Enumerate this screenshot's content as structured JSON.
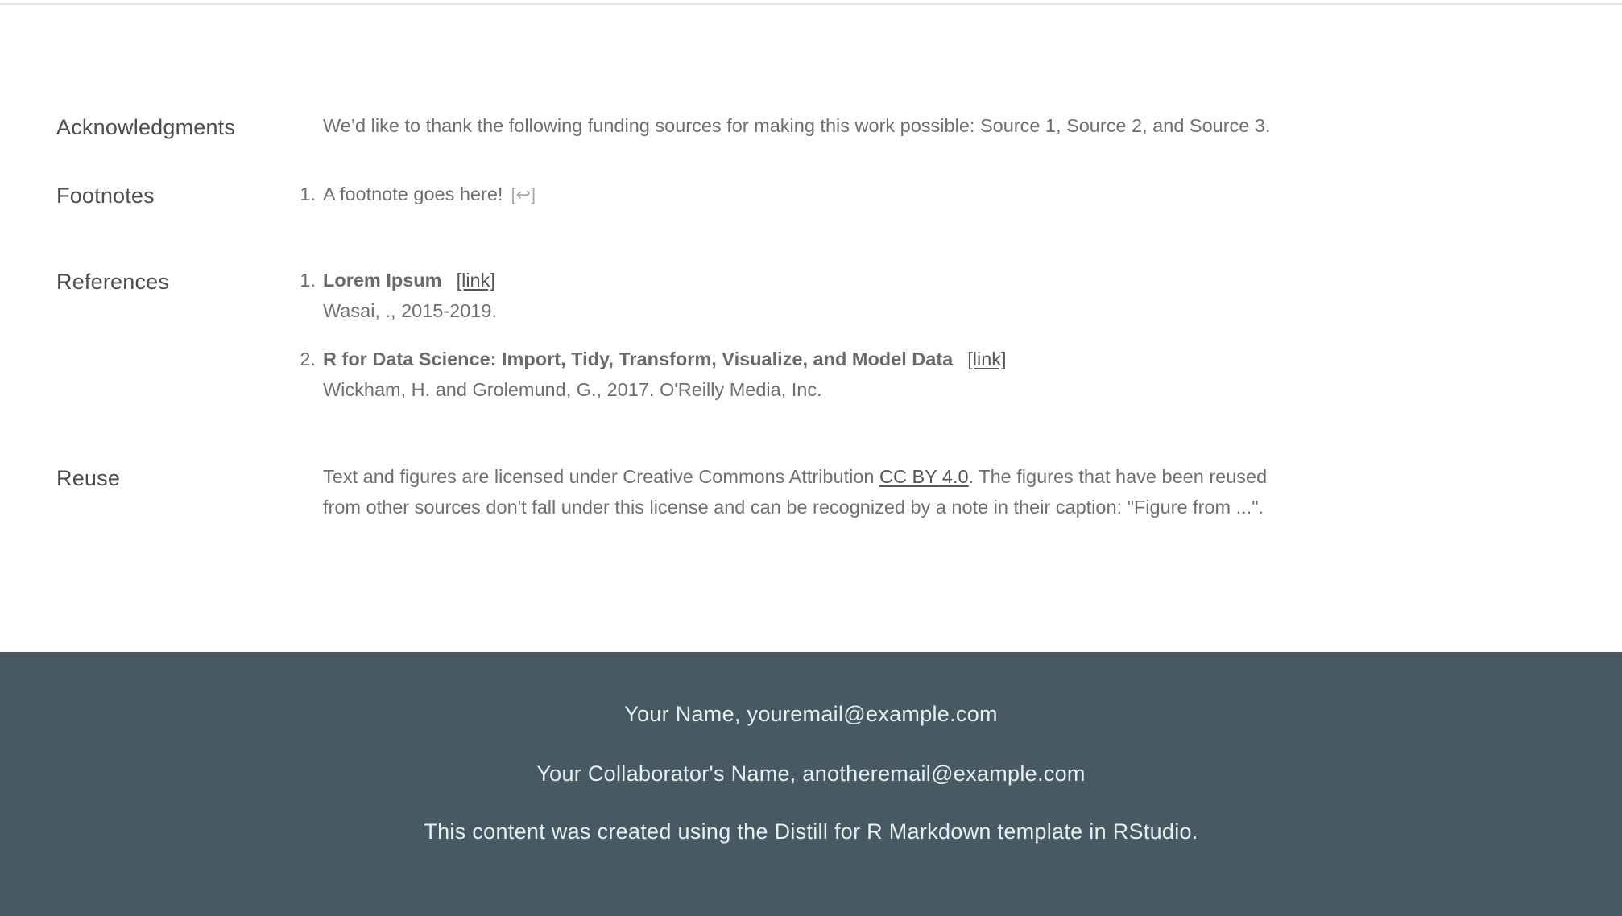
{
  "appendix": {
    "acknowledgments": {
      "heading": "Acknowledgments",
      "text": "We’d like to thank the following funding sources for making this work possible: Source 1, Source 2, and Source 3."
    },
    "footnotes": {
      "heading": "Footnotes",
      "items": [
        {
          "number": "1.",
          "text": "A footnote goes here!",
          "backref": "[↩]"
        }
      ]
    },
    "references": {
      "heading": "References",
      "items": [
        {
          "number": "1.",
          "title": "Lorem Ipsum",
          "link": "[link]",
          "details": "Wasai, ., 2015-2019."
        },
        {
          "number": "2.",
          "title": "R for Data Science: Import, Tidy, Transform, Visualize, and Model Data",
          "link": "[link]",
          "details": "Wickham, H. and Grolemund, G., 2017. O'Reilly Media, Inc."
        }
      ]
    },
    "reuse": {
      "heading": "Reuse",
      "text_before": "Text and figures are licensed under Creative Commons Attribution ",
      "license_link": "CC BY 4.0",
      "text_after": ". The figures that have been reused",
      "line2": "from other sources don't fall under this license and can be recognized by a note in their caption: \"Figure from ...\"."
    }
  },
  "footer": {
    "line1": "Your Name, youremail@example.com",
    "line2": "Your Collaborator's Name, anotheremail@example.com",
    "line3": "This content was created using the Distill for R Markdown template in RStudio."
  },
  "colors": {
    "footer_bg": "#475963",
    "footer_text": "#e9eef0",
    "body_text": "#6f6f6f",
    "heading_text": "#4d4d4d"
  }
}
